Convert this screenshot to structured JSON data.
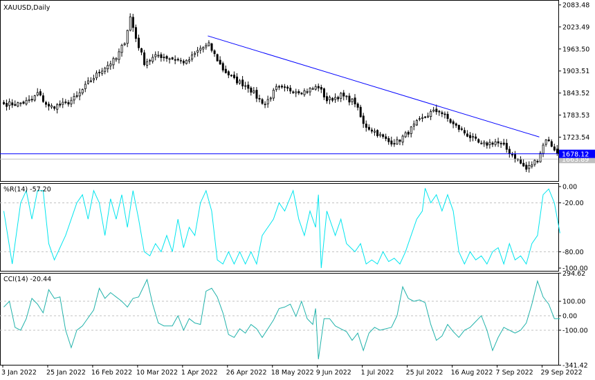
{
  "chart_data": [
    {
      "type": "candlestick",
      "title": "XAUUSD,Daily",
      "symbol": "XAUUSD",
      "timeframe": "Daily",
      "ylim": [
        1604,
        2090
      ],
      "y_ticks": [
        "2083.48",
        "2023.49",
        "1963.50",
        "1903.51",
        "1843.52",
        "1783.53",
        "1723.54"
      ],
      "y_tick_values": [
        2083.48,
        2023.49,
        1963.5,
        1903.51,
        1843.52,
        1783.53,
        1723.54
      ],
      "bid_label": "1678.12",
      "bid_value": 1678.12,
      "last_label": "1663.89",
      "last_value": 1663.89,
      "trendline": {
        "from": [
          73,
          1999
        ],
        "to": [
          191,
          1724
        ]
      },
      "bar_count": 199,
      "close_keyframes": [
        [
          0,
          1814
        ],
        [
          5,
          1814
        ],
        [
          10,
          1824
        ],
        [
          12,
          1843
        ],
        [
          16,
          1805
        ],
        [
          22,
          1814
        ],
        [
          26,
          1833
        ],
        [
          30,
          1871
        ],
        [
          35,
          1908
        ],
        [
          40,
          1937
        ],
        [
          43,
          1984
        ],
        [
          45,
          2050
        ],
        [
          47,
          1993
        ],
        [
          50,
          1927
        ],
        [
          55,
          1946
        ],
        [
          60,
          1937
        ],
        [
          65,
          1927
        ],
        [
          70,
          1965
        ],
        [
          73,
          1974
        ],
        [
          78,
          1908
        ],
        [
          82,
          1880
        ],
        [
          87,
          1861
        ],
        [
          90,
          1833
        ],
        [
          93,
          1814
        ],
        [
          97,
          1856
        ],
        [
          102,
          1852
        ],
        [
          107,
          1848
        ],
        [
          112,
          1861
        ],
        [
          115,
          1824
        ],
        [
          120,
          1837
        ],
        [
          125,
          1818
        ],
        [
          128,
          1758
        ],
        [
          132,
          1739
        ],
        [
          137,
          1711
        ],
        [
          140,
          1711
        ],
        [
          143,
          1730
        ],
        [
          147,
          1762
        ],
        [
          152,
          1790
        ],
        [
          155,
          1796
        ],
        [
          160,
          1758
        ],
        [
          165,
          1730
        ],
        [
          170,
          1702
        ],
        [
          175,
          1711
        ],
        [
          178,
          1698
        ],
        [
          182,
          1668
        ],
        [
          186,
          1636
        ],
        [
          190,
          1664
        ],
        [
          193,
          1720
        ],
        [
          196,
          1692
        ],
        [
          198,
          1663.89
        ]
      ]
    },
    {
      "type": "line",
      "title": "%R(14) -57.20",
      "ylim": [
        -100,
        0
      ],
      "y_ticks": [
        "0.00",
        "-20.00",
        "-80.00",
        "-100.00"
      ],
      "y_tick_values": [
        0,
        -20,
        -80,
        -100
      ],
      "levels": [
        -20,
        -80
      ],
      "color": "#00e5ee",
      "keyframes": [
        [
          0,
          -30
        ],
        [
          3,
          -95
        ],
        [
          6,
          -20
        ],
        [
          8,
          -5
        ],
        [
          10,
          -40
        ],
        [
          12,
          -5
        ],
        [
          14,
          -5
        ],
        [
          16,
          -70
        ],
        [
          18,
          -90
        ],
        [
          22,
          -60
        ],
        [
          26,
          -20
        ],
        [
          28,
          -10
        ],
        [
          30,
          -40
        ],
        [
          32,
          -5
        ],
        [
          34,
          -20
        ],
        [
          36,
          -60
        ],
        [
          38,
          -15
        ],
        [
          40,
          -40
        ],
        [
          42,
          -10
        ],
        [
          44,
          -50
        ],
        [
          46,
          -5
        ],
        [
          48,
          -40
        ],
        [
          50,
          -80
        ],
        [
          52,
          -85
        ],
        [
          54,
          -70
        ],
        [
          56,
          -80
        ],
        [
          58,
          -60
        ],
        [
          60,
          -80
        ],
        [
          62,
          -40
        ],
        [
          64,
          -75
        ],
        [
          66,
          -50
        ],
        [
          68,
          -60
        ],
        [
          70,
          -20
        ],
        [
          72,
          -5
        ],
        [
          74,
          -30
        ],
        [
          76,
          -90
        ],
        [
          78,
          -95
        ],
        [
          80,
          -80
        ],
        [
          82,
          -95
        ],
        [
          84,
          -80
        ],
        [
          86,
          -95
        ],
        [
          88,
          -80
        ],
        [
          90,
          -95
        ],
        [
          92,
          -60
        ],
        [
          94,
          -50
        ],
        [
          96,
          -40
        ],
        [
          98,
          -20
        ],
        [
          100,
          -30
        ],
        [
          103,
          -5
        ],
        [
          105,
          -40
        ],
        [
          107,
          -60
        ],
        [
          109,
          -30
        ],
        [
          111,
          -50
        ],
        [
          112,
          -10
        ],
        [
          113,
          -100
        ],
        [
          115,
          -30
        ],
        [
          118,
          -60
        ],
        [
          120,
          -40
        ],
        [
          122,
          -70
        ],
        [
          125,
          -80
        ],
        [
          127,
          -70
        ],
        [
          129,
          -95
        ],
        [
          131,
          -90
        ],
        [
          133,
          -95
        ],
        [
          135,
          -80
        ],
        [
          137,
          -92
        ],
        [
          139,
          -88
        ],
        [
          141,
          -95
        ],
        [
          143,
          -80
        ],
        [
          145,
          -60
        ],
        [
          147,
          -40
        ],
        [
          149,
          -30
        ],
        [
          150,
          -2
        ],
        [
          152,
          -20
        ],
        [
          154,
          -10
        ],
        [
          156,
          -30
        ],
        [
          158,
          -10
        ],
        [
          160,
          -30
        ],
        [
          162,
          -80
        ],
        [
          164,
          -95
        ],
        [
          166,
          -80
        ],
        [
          168,
          -90
        ],
        [
          170,
          -85
        ],
        [
          172,
          -95
        ],
        [
          174,
          -80
        ],
        [
          176,
          -75
        ],
        [
          178,
          -95
        ],
        [
          180,
          -70
        ],
        [
          182,
          -90
        ],
        [
          184,
          -85
        ],
        [
          186,
          -95
        ],
        [
          188,
          -70
        ],
        [
          190,
          -60
        ],
        [
          192,
          -10
        ],
        [
          194,
          -3
        ],
        [
          196,
          -20
        ],
        [
          198,
          -57.2
        ]
      ]
    },
    {
      "type": "line",
      "title": "CCI(14) -20.44",
      "ylim": [
        -341.42,
        294.62
      ],
      "y_ticks": [
        "294.62",
        "100.00",
        "0.00",
        "-100.00",
        "-341.42"
      ],
      "y_tick_values": [
        294.62,
        100,
        0,
        -100,
        -341.42
      ],
      "levels": [
        100,
        0,
        -100
      ],
      "color": "#20b2aa",
      "keyframes": [
        [
          0,
          60
        ],
        [
          2,
          100
        ],
        [
          4,
          -80
        ],
        [
          6,
          -100
        ],
        [
          8,
          -20
        ],
        [
          10,
          120
        ],
        [
          12,
          80
        ],
        [
          14,
          20
        ],
        [
          16,
          180
        ],
        [
          18,
          120
        ],
        [
          20,
          130
        ],
        [
          22,
          -100
        ],
        [
          24,
          -220
        ],
        [
          26,
          -100
        ],
        [
          28,
          -70
        ],
        [
          32,
          40
        ],
        [
          34,
          190
        ],
        [
          36,
          120
        ],
        [
          38,
          160
        ],
        [
          42,
          100
        ],
        [
          44,
          60
        ],
        [
          46,
          120
        ],
        [
          48,
          130
        ],
        [
          51,
          250
        ],
        [
          53,
          80
        ],
        [
          55,
          -50
        ],
        [
          57,
          -70
        ],
        [
          60,
          -70
        ],
        [
          62,
          0
        ],
        [
          64,
          -100
        ],
        [
          66,
          -20
        ],
        [
          68,
          -50
        ],
        [
          70,
          -60
        ],
        [
          72,
          170
        ],
        [
          74,
          190
        ],
        [
          76,
          130
        ],
        [
          78,
          20
        ],
        [
          80,
          -130
        ],
        [
          82,
          -150
        ],
        [
          84,
          -90
        ],
        [
          86,
          -120
        ],
        [
          88,
          -60
        ],
        [
          90,
          -90
        ],
        [
          92,
          -150
        ],
        [
          94,
          -90
        ],
        [
          96,
          -30
        ],
        [
          98,
          50
        ],
        [
          100,
          60
        ],
        [
          102,
          80
        ],
        [
          104,
          -5
        ],
        [
          106,
          100
        ],
        [
          108,
          -20
        ],
        [
          110,
          -60
        ],
        [
          111,
          50
        ],
        [
          112,
          -300
        ],
        [
          114,
          -20
        ],
        [
          116,
          -20
        ],
        [
          118,
          -70
        ],
        [
          120,
          -90
        ],
        [
          122,
          -110
        ],
        [
          124,
          -170
        ],
        [
          126,
          -120
        ],
        [
          128,
          -240
        ],
        [
          130,
          -120
        ],
        [
          132,
          -80
        ],
        [
          134,
          -100
        ],
        [
          136,
          -90
        ],
        [
          138,
          -80
        ],
        [
          140,
          0
        ],
        [
          142,
          200
        ],
        [
          144,
          120
        ],
        [
          146,
          100
        ],
        [
          148,
          110
        ],
        [
          150,
          90
        ],
        [
          152,
          -60
        ],
        [
          154,
          -170
        ],
        [
          156,
          -140
        ],
        [
          158,
          -60
        ],
        [
          160,
          -110
        ],
        [
          162,
          -150
        ],
        [
          164,
          -100
        ],
        [
          166,
          -80
        ],
        [
          168,
          -40
        ],
        [
          170,
          0
        ],
        [
          172,
          -100
        ],
        [
          174,
          -240
        ],
        [
          176,
          -150
        ],
        [
          178,
          -80
        ],
        [
          180,
          -100
        ],
        [
          182,
          -120
        ],
        [
          184,
          -100
        ],
        [
          186,
          -50
        ],
        [
          188,
          80
        ],
        [
          190,
          240
        ],
        [
          192,
          130
        ],
        [
          194,
          80
        ],
        [
          196,
          -20
        ],
        [
          198,
          -20.44
        ]
      ]
    }
  ],
  "x_axis": {
    "labels": [
      "3 Jan 2022",
      "25 Jan 2022",
      "16 Feb 2022",
      "10 Mar 2022",
      "1 Apr 2022",
      "26 Apr 2022",
      "18 May 2022",
      "9 Jun 2022",
      "1 Jul 2022",
      "25 Jul 2022",
      "16 Aug 2022",
      "7 Sep 2022",
      "29 Sep 2022"
    ],
    "label_bar_index": [
      0,
      16,
      32,
      48,
      64,
      80,
      96,
      112,
      128,
      144,
      160,
      176,
      192
    ]
  },
  "colors": {
    "trendline": "#0000ff",
    "bid": "#0000ff",
    "last": "#c0c0c0",
    "grid": "#c0c0c0"
  }
}
